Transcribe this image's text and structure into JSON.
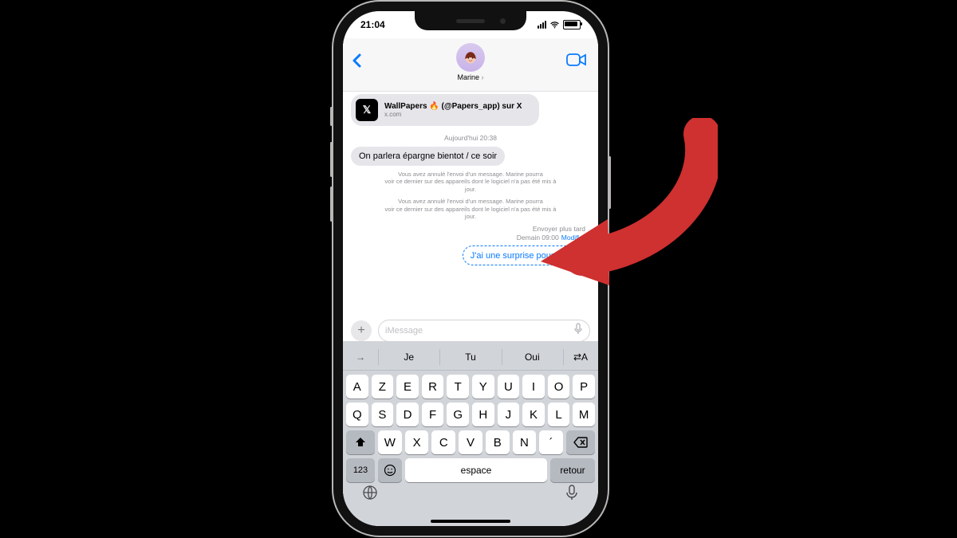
{
  "status": {
    "time": "21:04"
  },
  "header": {
    "contact_name": "Marine"
  },
  "conv": {
    "link_card": {
      "title": "WallPapers 🔥 (@Papers_app) sur X",
      "subtitle": "x.com",
      "thumb_text": "𝕏"
    },
    "time_separator": "Aujourd'hui 20:38",
    "incoming_1": "On parlera épargne bientot / ce soir",
    "system_1": "Vous avez annulé l'envoi d'un message. Marine pourra\nvoir ce dernier sur des appareils dont le logiciel n'a pas été mis à\njour.",
    "system_2": "Vous avez annulé l'envoi d'un message. Marine pourra\nvoir ce dernier sur des appareils dont le logiciel n'a pas été mis à\njour.",
    "send_later": {
      "label": "Envoyer plus tard",
      "time": "Demain 09:00",
      "edit": "Modifier"
    },
    "outgoing_scheduled": "J'ai une surprise pour toi 🤫"
  },
  "composer": {
    "placeholder": "iMessage"
  },
  "keyboard": {
    "suggestions": [
      "→",
      "Je",
      "Tu",
      "Oui",
      "⇄A"
    ],
    "row1": [
      "A",
      "Z",
      "E",
      "R",
      "T",
      "Y",
      "U",
      "I",
      "O",
      "P"
    ],
    "row2": [
      "Q",
      "S",
      "D",
      "F",
      "G",
      "H",
      "J",
      "K",
      "L",
      "M"
    ],
    "row3": [
      "W",
      "X",
      "C",
      "V",
      "B",
      "N",
      "´"
    ],
    "num_key": "123",
    "space": "espace",
    "return": "retour"
  }
}
